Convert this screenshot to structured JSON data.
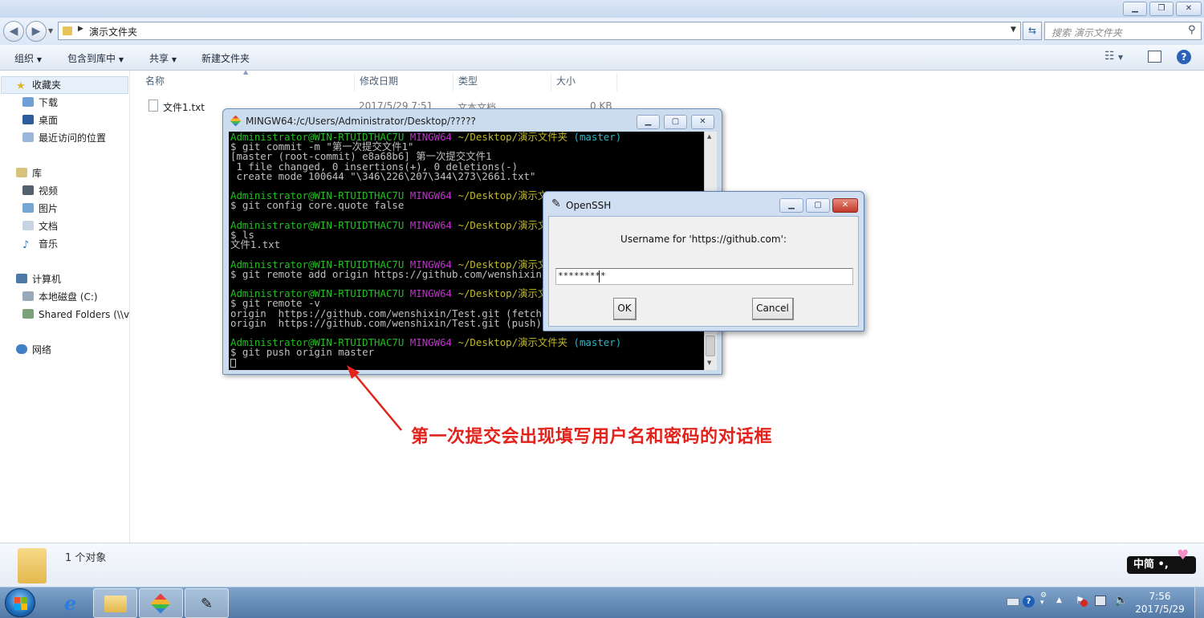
{
  "explorer": {
    "address": "演示文件夹",
    "search_placeholder": "搜索 演示文件夹",
    "toolbar": {
      "organize": "组织",
      "include_in_library": "包含到库中",
      "share": "共享",
      "new_folder": "新建文件夹"
    },
    "nav": {
      "favorites": "收藏夹",
      "downloads": "下载",
      "desktop": "桌面",
      "recent": "最近访问的位置",
      "libraries": "库",
      "videos": "视频",
      "pictures": "图片",
      "documents": "文档",
      "music": "音乐",
      "computer": "计算机",
      "local_disk": "本地磁盘 (C:)",
      "shared_folders": "Shared Folders (\\\\v",
      "network": "网络"
    },
    "columns": {
      "name": "名称",
      "modified": "修改日期",
      "type": "类型",
      "size": "大小"
    },
    "files": [
      {
        "name": "文件1.txt",
        "modified": "2017/5/29 7:51",
        "type": "文本文档",
        "size": "0 KB"
      }
    ],
    "status": "1 个对象"
  },
  "terminal": {
    "title": "MINGW64:/c/Users/Administrator/Desktop/?????",
    "lines": [
      {
        "user": "Administrator@WIN-RTUIDTHAC7U",
        "host": "MINGW64",
        "path": "~/Desktop/演示文件夹",
        "branch": "(master)"
      },
      {
        "text": "$ git commit -m \"第一次提交文件1\""
      },
      {
        "text": "[master (root-commit) e8a68b6] 第一次提交文件1"
      },
      {
        "text": " 1 file changed, 0 insertions(+), 0 deletions(-)"
      },
      {
        "text": " create mode 100644 \"\\346\\226\\207\\344\\273\\2661.txt\""
      },
      {
        "text": ""
      },
      {
        "user": "Administrator@WIN-RTUIDTHAC7U",
        "host": "MINGW64",
        "path": "~/Desktop/演示文",
        "branch": ""
      },
      {
        "text": "$ git config core.quote false"
      },
      {
        "text": ""
      },
      {
        "user": "Administrator@WIN-RTUIDTHAC7U",
        "host": "MINGW64",
        "path": "~/Desktop/演示文",
        "branch": ""
      },
      {
        "text": "$ ls"
      },
      {
        "text": "文件1.txt"
      },
      {
        "text": ""
      },
      {
        "user": "Administrator@WIN-RTUIDTHAC7U",
        "host": "MINGW64",
        "path": "~/Desktop/演示文",
        "branch": ""
      },
      {
        "text": "$ git remote add origin https://github.com/wenshixin/"
      },
      {
        "text": ""
      },
      {
        "user": "Administrator@WIN-RTUIDTHAC7U",
        "host": "MINGW64",
        "path": "~/Desktop/演示文",
        "branch": ""
      },
      {
        "text": "$ git remote -v"
      },
      {
        "text": "origin  https://github.com/wenshixin/Test.git (fetch)"
      },
      {
        "text": "origin  https://github.com/wenshixin/Test.git (push)"
      },
      {
        "text": ""
      },
      {
        "user": "Administrator@WIN-RTUIDTHAC7U",
        "host": "MINGW64",
        "path": "~/Desktop/演示文件夹",
        "branch": "(master)"
      },
      {
        "text": "$ git push origin master"
      }
    ]
  },
  "dialog": {
    "title": "OpenSSH",
    "prompt": "Username for 'https://github.com':",
    "input_value": "*********",
    "ok": "OK",
    "cancel": "Cancel"
  },
  "annotation": "第一次提交会出现填写用户名和密码的对话框",
  "taskbar": {
    "time": "7:56",
    "date": "2017/5/29",
    "ime": "中简 •,"
  },
  "colors": {
    "annotation": "#e2221b",
    "terminal_bg": "#000000",
    "prompt_user": "#1fc01f",
    "prompt_host": "#c42fd0",
    "prompt_path": "#c4bb2a",
    "prompt_branch": "#2fb8c8"
  }
}
